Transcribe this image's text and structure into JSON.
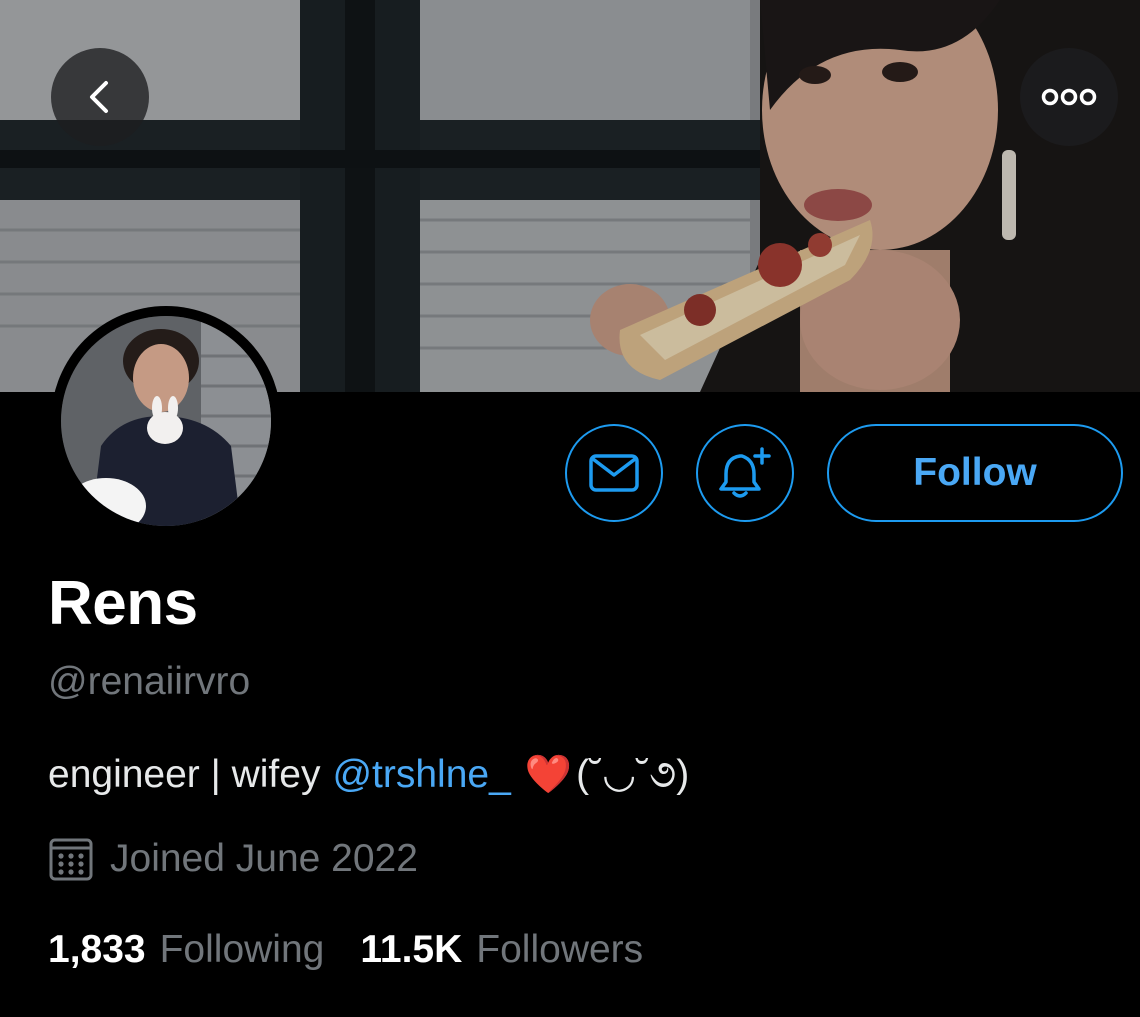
{
  "header": {
    "back_icon": "chevron-left-icon",
    "more_icon": "more-horizontal-icon"
  },
  "actions": {
    "message_icon": "envelope-icon",
    "notify_icon": "bell-plus-icon",
    "follow_label": "Follow"
  },
  "profile": {
    "display_name": "Rens",
    "handle": "@renaiirvro",
    "bio": {
      "text": "engineer | wifey",
      "mention": "@trshlne_",
      "emoji": "❤️",
      "kaomoji": "(˘◡˘૭)"
    },
    "joined": "Joined June 2022",
    "following_count": "1,833",
    "following_label": "Following",
    "followers_count": "11.5K",
    "followers_label": "Followers"
  },
  "colors": {
    "accent": "#1d9bf0",
    "background": "#000000",
    "secondary_text": "#71767b"
  }
}
